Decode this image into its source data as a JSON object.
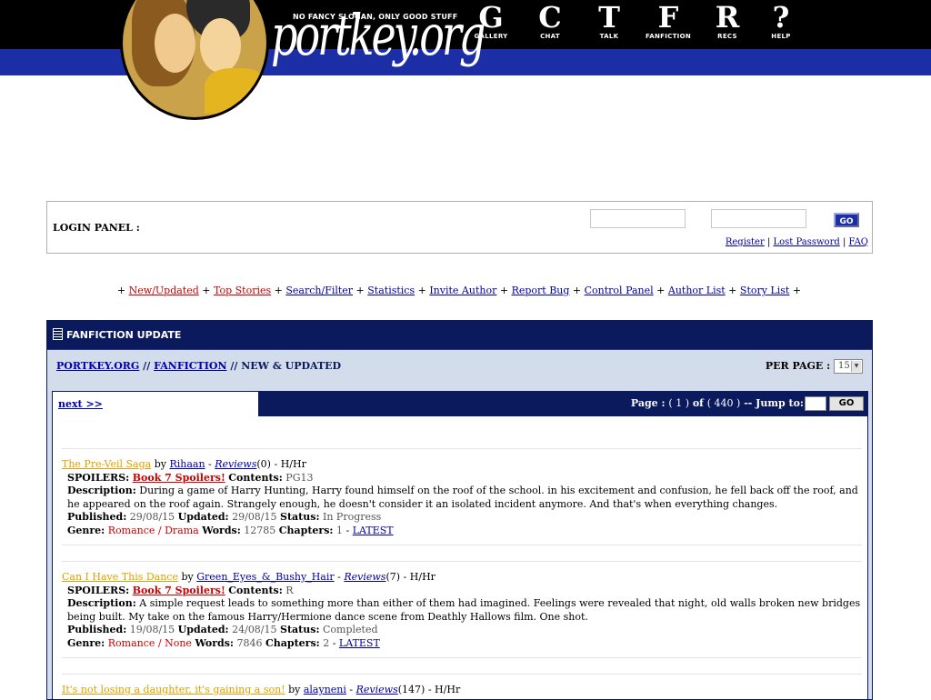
{
  "site": {
    "slogan": "NO FANCY SLOGAN, ONLY GOOD STUFF",
    "logo_text": "portkey.org",
    "nav": [
      {
        "letter": "G",
        "label": "GALLERY"
      },
      {
        "letter": "C",
        "label": "CHAT"
      },
      {
        "letter": "T",
        "label": "TALK"
      },
      {
        "letter": "F",
        "label": "FANFICTION"
      },
      {
        "letter": "R",
        "label": "RECS"
      },
      {
        "letter": "?",
        "label": "HELP"
      }
    ]
  },
  "login": {
    "label": "LOGIN PANEL :",
    "go": "GO",
    "register": "Register",
    "lost_password": "Lost Password",
    "faq": "FAQ"
  },
  "menu": {
    "new_updated": "New/Updated",
    "top_stories": "Top Stories",
    "search_filter": "Search/Filter",
    "statistics": "Statistics",
    "invite_author": "Invite Author",
    "report_bug": "Report Bug",
    "control_panel": "Control Panel",
    "author_list": "Author List",
    "story_list": "Story List"
  },
  "panel": {
    "title": "FANFICTION UPDATE",
    "crumb_home": "PORTKEY.ORG",
    "crumb_sep": "//",
    "crumb_fanfiction": "FANFICTION",
    "crumb_current": "NEW & UPDATED",
    "per_page_label": "PER PAGE :",
    "per_page_value": "15",
    "next": "next >>",
    "page_label": "Page :",
    "page_current": "( 1 )",
    "of": "of",
    "page_total": "( 440 )",
    "jump_to": "-- Jump to:",
    "go": "GO"
  },
  "labels": {
    "by": "by",
    "reviews": "Reviews",
    "spoilers": "SPOILERS:",
    "contents": "Contents:",
    "description": "Description:",
    "published": "Published:",
    "updated": "Updated:",
    "status": "Status:",
    "genre": "Genre:",
    "words": "Words:",
    "chapters": "Chapters:",
    "latest": "LATEST"
  },
  "stories": [
    {
      "title": "The Pre-Veil Saga",
      "author": "Rihaan",
      "review_count": "(0)",
      "pairing": "H/Hr",
      "spoilers": "Book 7 Spoilers!",
      "contents": "PG13",
      "description": "During a game of Harry Hunting, Harry found himself on the roof of the school. in his excitement and confusion, he fell back off the roof, and he appeared on the roof again. Strangely enough, he doesn't consider it an isolated incident anymore. And that's when everything changes.",
      "published": "29/08/15",
      "updated": "29/08/15",
      "status": "In Progress",
      "genre": "Romance / Drama",
      "words": "12785",
      "chapters": "1"
    },
    {
      "title": "Can I Have This Dance",
      "author": "Green_Eyes_&_Bushy_Hair",
      "review_count": "(7)",
      "pairing": "H/Hr",
      "spoilers": "Book 7 Spoilers!",
      "contents": "R",
      "description": "A simple request leads to something more than either of them had imagined. Feelings were revealed that night, old walls broken new bridges being built. My take on the famous Harry/Hermione dance scene from Deathly Hallows film. One shot.",
      "published": "19/08/15",
      "updated": "24/08/15",
      "status": "Completed",
      "genre": "Romance / None",
      "words": "7846",
      "chapters": "2"
    },
    {
      "title": "It's not losing a daughter, it's gaining a son!",
      "author": "alayneni",
      "review_count": "(147)",
      "pairing": "H/Hr"
    }
  ]
}
